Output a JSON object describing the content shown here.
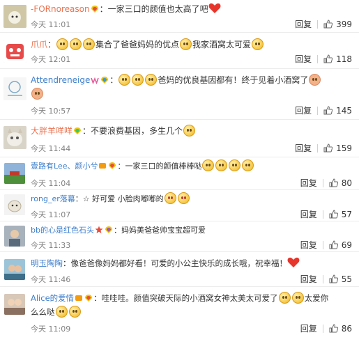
{
  "comments": [
    {
      "user": "-FORnoreason",
      "text": "：一家三口的颜值也太高了吧",
      "time": "今天 11:01",
      "reply": "回复",
      "likes": "399"
    },
    {
      "user": "爪爪",
      "text": "集合了爸爸妈妈的优点",
      "text2": "我家酒窝太可爱",
      "time": "今天 12:01",
      "reply": "回复",
      "likes": "118"
    },
    {
      "user": "Attendreneige",
      "text": "爸妈的优良基因都有！终于见着小酒窝了",
      "time": "今天 10:57",
      "reply": "回复",
      "likes": "145"
    },
    {
      "user": "大胖羊咩咩",
      "text": "：不要浪费基因，多生几个",
      "time": "今天 11:44",
      "reply": "回复",
      "likes": "159"
    },
    {
      "user": "壹路有Lee、颜小兮",
      "text": "：一家三口的颜值棒棒哒",
      "time": "今天 11:04",
      "reply": "回复",
      "likes": "80"
    },
    {
      "user": "rong_er落幕",
      "text": "：☆ 好可爱 小脸肉嘟嘟的",
      "time": "今天 11:07",
      "reply": "回复",
      "likes": "57"
    },
    {
      "user": "bb的心是红色石头",
      "text": "：妈妈美爸爸帅宝宝超可爱",
      "time": "今天 11:33",
      "reply": "回复",
      "likes": "69"
    },
    {
      "user": "明玉陶陶",
      "text": "：像爸爸像妈妈都好看！可爱的小公主快乐的成长哦，祝幸福！",
      "time": "今天 11:46",
      "reply": "回复",
      "likes": "55"
    },
    {
      "user": "Alice的爱情",
      "text": "：哇哇哇。颜值突破天际的小酒窝女神太美太可爱了",
      "text2": "太爱你",
      "text3": "么么哒",
      "time": "今天 11:09",
      "reply": "回复",
      "likes": "86"
    }
  ],
  "colors": {
    "username": "#eb7350",
    "link": "#3e7fcb",
    "meta": "#808080"
  }
}
